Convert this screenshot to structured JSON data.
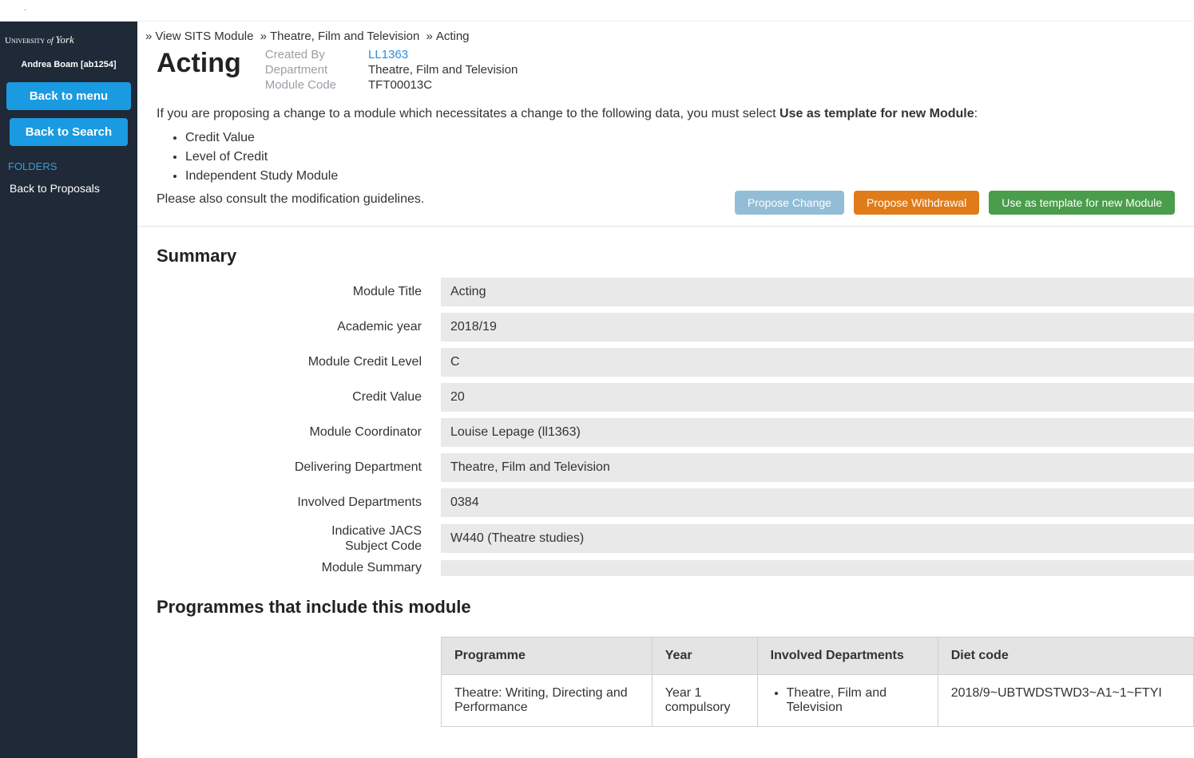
{
  "user": "Andrea Boam [ab1254]",
  "sidebar": {
    "back_to_menu": "Back to menu",
    "back_to_search": "Back to Search",
    "folders_label": "FOLDERS",
    "back_to_proposals": "Back to Proposals"
  },
  "breadcrumb": {
    "item1": "View SITS Module",
    "item2": "Theatre, Film and Television",
    "item3": "Acting"
  },
  "page_title": "Acting",
  "meta": {
    "created_by_label": "Created By",
    "created_by_value": "LL1363",
    "department_label": "Department",
    "department_value": "Theatre, Film and Television",
    "module_code_label": "Module Code",
    "module_code_value": "TFT00013C"
  },
  "info": {
    "text_pre": "If you are proposing a change to a module which necessitates a change to the following data, you must select ",
    "text_bold": "Use as template for new Module",
    "bullets": {
      "b1": "Credit Value",
      "b2": "Level of Credit",
      "b3": "Independent Study Module"
    },
    "guidelines": "Please also consult the modification guidelines."
  },
  "actions": {
    "propose_change": "Propose Change",
    "propose_withdrawal": "Propose Withdrawal",
    "use_template": "Use as template for new Module"
  },
  "summary": {
    "heading": "Summary",
    "labels": {
      "module_title": "Module Title",
      "academic_year": "Academic year",
      "credit_level": "Module Credit Level",
      "credit_value": "Credit Value",
      "coordinator": "Module Coordinator",
      "delivering_dept": "Delivering Department",
      "involved_depts": "Involved Departments",
      "jacs": "Indicative JACS Subject Code",
      "module_summary": "Module Summary"
    },
    "values": {
      "module_title": "Acting",
      "academic_year": "2018/19",
      "credit_level": "C",
      "credit_value": "20",
      "coordinator": "Louise Lepage (ll1363)",
      "delivering_dept": "Theatre, Film and Television",
      "involved_depts": "0384",
      "jacs": "W440 (Theatre studies)",
      "module_summary": ""
    }
  },
  "programmes": {
    "heading": "Programmes that include this module",
    "headers": {
      "programme": "Programme",
      "year": "Year",
      "involved": "Involved Departments",
      "diet": "Diet code"
    },
    "row1": {
      "programme": "Theatre: Writing, Directing and Performance",
      "year": "Year 1 compulsory",
      "involved": "Theatre, Film and Television",
      "diet": "2018/9~UBTWDSTWD3~A1~1~FTYI"
    }
  }
}
